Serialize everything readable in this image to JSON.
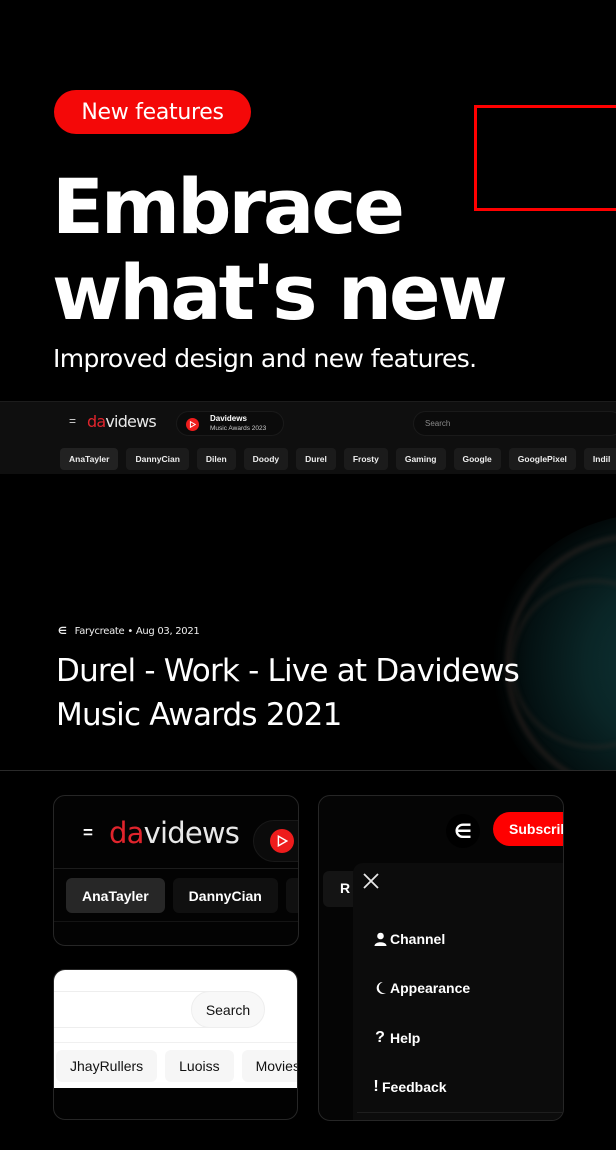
{
  "hero": {
    "badge": "New features",
    "title_line1": "Embrace",
    "title_line2": "what's new",
    "subtitle": "Improved design and new features."
  },
  "brand": {
    "logo_accent": "da",
    "logo_rest": "videws",
    "accent_color": "#e0242c",
    "badge_color": "#f40808"
  },
  "navbar": {
    "menu_icon": "menu-icon",
    "channel_name": "Davidews",
    "channel_subtitle": "Music Awards 2023",
    "search_placeholder": "Search",
    "chips": [
      "AnaTayler",
      "DannyCian",
      "Dilen",
      "Doody",
      "Durel",
      "Frosty",
      "Gaming",
      "Google",
      "GooglePixel",
      "Indil"
    ]
  },
  "video": {
    "channel": "Farycreate",
    "separator": "•",
    "date": "Aug 03, 2021",
    "title": "Durel - Work - Live at Davidews Music Awards 2021"
  },
  "card_dark": {
    "chips": [
      "AnaTayler",
      "DannyCian"
    ]
  },
  "card_light": {
    "search_button": "Search",
    "chips": [
      "JhayRullers",
      "Luoiss",
      "Movies"
    ]
  },
  "card_menu": {
    "subscribe_label": "Subscribe",
    "chip_partial": "R",
    "items": [
      {
        "icon": "user-icon",
        "label": "Channel"
      },
      {
        "icon": "moon-icon",
        "label": "Appearance"
      },
      {
        "icon": "help-icon",
        "label": "Help"
      },
      {
        "icon": "feedback-icon",
        "label": "Feedback"
      }
    ]
  }
}
